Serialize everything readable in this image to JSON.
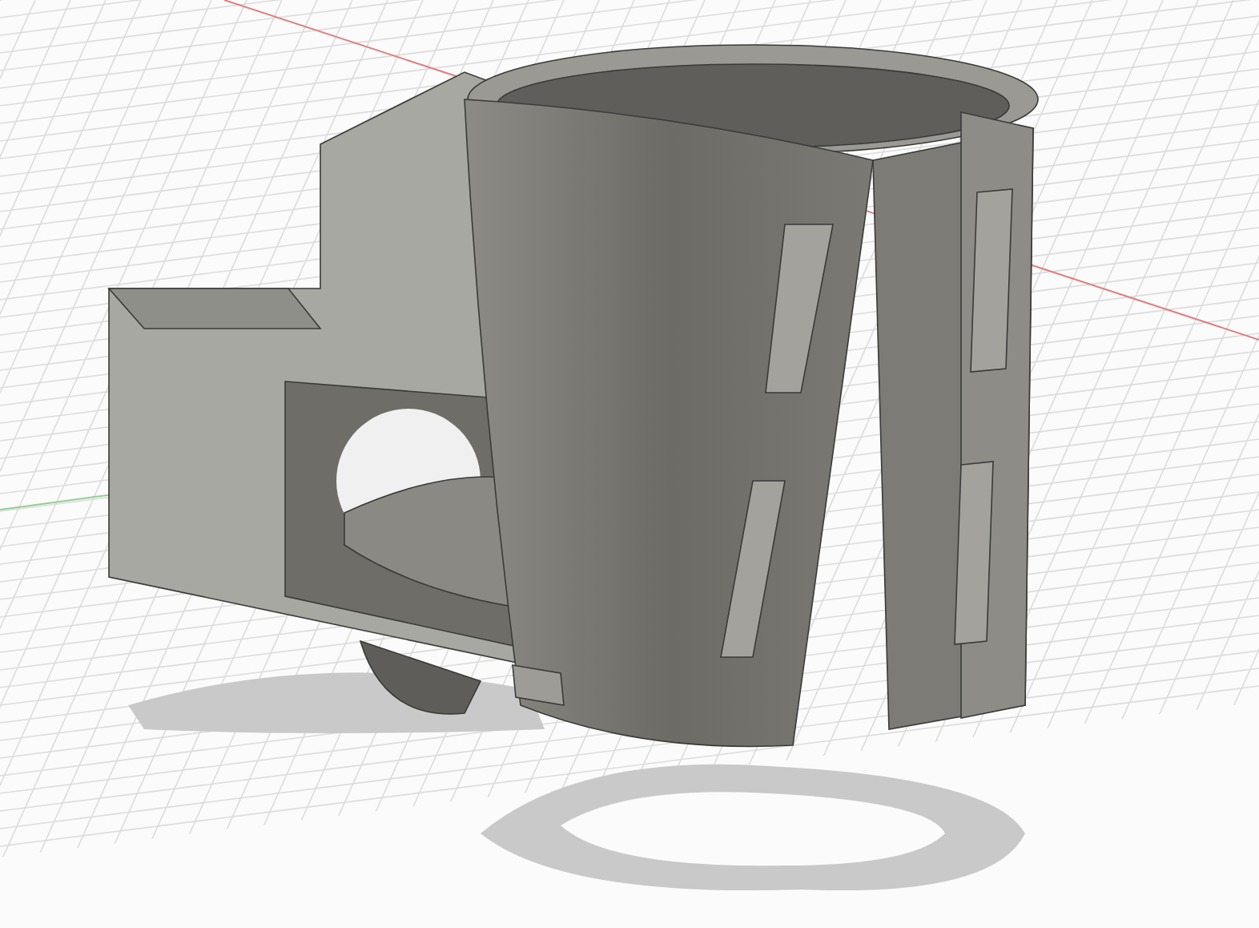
{
  "viewport": {
    "show_grid": true,
    "show_axes": true,
    "show_shadow": true
  }
}
